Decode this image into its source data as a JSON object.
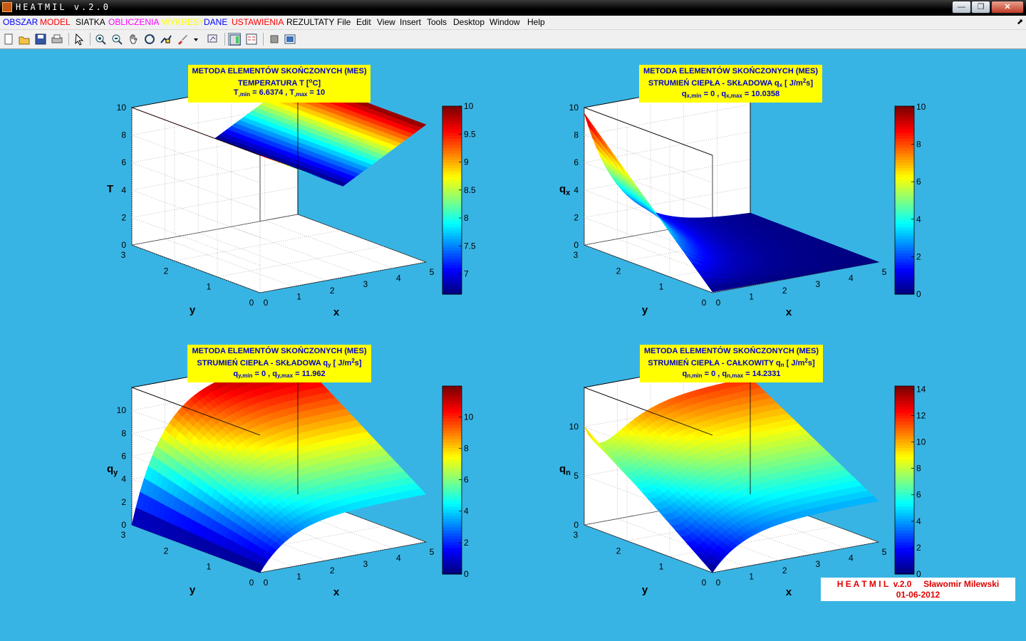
{
  "window": {
    "title": "HEATMIL v.2.0",
    "minimize": "0",
    "maximize": "1",
    "close": "r"
  },
  "menubar": {
    "items": [
      {
        "label": "OBSZAR",
        "color": "#0000FF"
      },
      {
        "label": "MODEL",
        "color": "#FF0000"
      },
      {
        "label": "SIATKA",
        "color": "#000000"
      },
      {
        "label": "OBLICZENIA",
        "color": "#FF00FF"
      },
      {
        "label": "WYKRESY",
        "color": "#FFFF00"
      },
      {
        "label": "DANE",
        "color": "#0000FF"
      },
      {
        "label": "USTAWIENIA",
        "color": "#FF0000"
      },
      {
        "label": "REZULTATY",
        "color": "#000000"
      },
      {
        "label": "File",
        "color": "#000000"
      },
      {
        "label": "Edit",
        "color": "#000000"
      },
      {
        "label": "View",
        "color": "#000000"
      },
      {
        "label": "Insert",
        "color": "#000000"
      },
      {
        "label": "Tools",
        "color": "#000000"
      },
      {
        "label": "Desktop",
        "color": "#000000"
      },
      {
        "label": "Window",
        "color": "#000000"
      },
      {
        "label": "Help",
        "color": "#000000"
      }
    ]
  },
  "toolbar": {
    "icons": [
      "new-file-icon",
      "open-folder-icon",
      "save-icon",
      "print-icon",
      "pointer-icon",
      "zoom-in-icon",
      "zoom-out-icon",
      "pan-hand-icon",
      "rotate-3d-icon",
      "data-cursor-icon",
      "brush-icon",
      "dropdown-arrow-icon",
      "link-plot-icon",
      "colorbar-icon",
      "legend-icon",
      "hide-tools-icon",
      "show-tools-icon"
    ]
  },
  "colors": {
    "background": "#38B4E4",
    "title_box": "#FFFF00",
    "title_text": "#0000C8"
  },
  "chart_data": [
    {
      "type": "surface",
      "title_line1": "METODA ELEMENTÓW SKOŃCZONYCH (MES)",
      "title_line2_parts": [
        "TEMPERATURA T [",
        "o",
        "C]"
      ],
      "title_line3_parts": [
        "T",
        ",min",
        " = 6.6374 , T",
        ",max",
        " = 10"
      ],
      "zlabel": "T",
      "zlabel_sub": "",
      "xlabel": "x",
      "ylabel": "y",
      "xticks": [
        "0",
        "1",
        "2",
        "3",
        "4",
        "5"
      ],
      "yticks": [
        "0",
        "1",
        "2",
        "3"
      ],
      "zticks": [
        "0",
        "2",
        "4",
        "6",
        "8",
        "10"
      ],
      "zlim": [
        0,
        10
      ],
      "colorbar_ticks": [
        "7",
        "7.5",
        "8",
        "8.5",
        "9",
        "9.5",
        "10"
      ],
      "colorbar_range": [
        6.6374,
        10
      ],
      "stats": {
        "min": 6.6374,
        "max": 10
      }
    },
    {
      "type": "surface",
      "title_line1": "METODA ELEMENTÓW SKOŃCZONYCH (MES)",
      "title_line2_parts": [
        "STRUMIEŃ CIEPŁA - SKŁADOWA q",
        "x",
        " [ J/m",
        "2",
        "s]"
      ],
      "title_line3_parts": [
        "q",
        "x,min",
        " = 0 , q",
        "x,max",
        " = 10.0358"
      ],
      "zlabel": "q",
      "zlabel_sub": "x",
      "xlabel": "x",
      "ylabel": "y",
      "xticks": [
        "0",
        "1",
        "2",
        "3",
        "4",
        "5"
      ],
      "yticks": [
        "0",
        "1",
        "2",
        "3"
      ],
      "zticks": [
        "0",
        "2",
        "4",
        "6",
        "8",
        "10"
      ],
      "zlim": [
        0,
        10
      ],
      "colorbar_ticks": [
        "0",
        "2",
        "4",
        "6",
        "8",
        "10"
      ],
      "colorbar_range": [
        0,
        10.0358
      ],
      "stats": {
        "min": 0,
        "max": 10.0358
      }
    },
    {
      "type": "surface",
      "title_line1": "METODA ELEMENTÓW SKOŃCZONYCH (MES)",
      "title_line2_parts": [
        "STRUMIEŃ CIEPŁA - SKŁADOWA q",
        "y",
        " [ J/m",
        "2",
        "s]"
      ],
      "title_line3_parts": [
        "q",
        "y,min",
        " = 0 , q",
        "y,max",
        " = 11.962"
      ],
      "zlabel": "q",
      "zlabel_sub": "y",
      "xlabel": "x",
      "ylabel": "y",
      "xticks": [
        "0",
        "1",
        "2",
        "3",
        "4",
        "5"
      ],
      "yticks": [
        "0",
        "1",
        "2",
        "3"
      ],
      "zticks": [
        "0",
        "2",
        "4",
        "6",
        "8",
        "10"
      ],
      "zlim": [
        0,
        12
      ],
      "colorbar_ticks": [
        "0",
        "2",
        "4",
        "6",
        "8",
        "10"
      ],
      "colorbar_range": [
        0,
        11.962
      ],
      "stats": {
        "min": 0,
        "max": 11.962
      }
    },
    {
      "type": "surface",
      "title_line1": "METODA ELEMENTÓW SKOŃCZONYCH (MES)",
      "title_line2_parts": [
        "STRUMIEŃ CIEPŁA - CAŁKOWITY q",
        "n",
        " [ J/m",
        "2",
        "s]"
      ],
      "title_line3_parts": [
        "q",
        "n,min",
        " = 0 , q",
        "n,max",
        " = 14.2331"
      ],
      "zlabel": "q",
      "zlabel_sub": "n",
      "xlabel": "x",
      "ylabel": "y",
      "xticks": [
        "0",
        "1",
        "2",
        "3",
        "4",
        "5"
      ],
      "yticks": [
        "0",
        "1",
        "2",
        "3"
      ],
      "zticks": [
        "0",
        "5",
        "10"
      ],
      "zlim": [
        0,
        14
      ],
      "colorbar_ticks": [
        "0",
        "2",
        "4",
        "6",
        "8",
        "10",
        "12",
        "14"
      ],
      "colorbar_range": [
        0,
        14.2331
      ],
      "stats": {
        "min": 0,
        "max": 14.2331
      }
    }
  ],
  "credit": {
    "line1_a": "H E A T M I L  v.2.0",
    "line1_b": "Sławomir Milewski",
    "line2": "01-06-2012"
  }
}
